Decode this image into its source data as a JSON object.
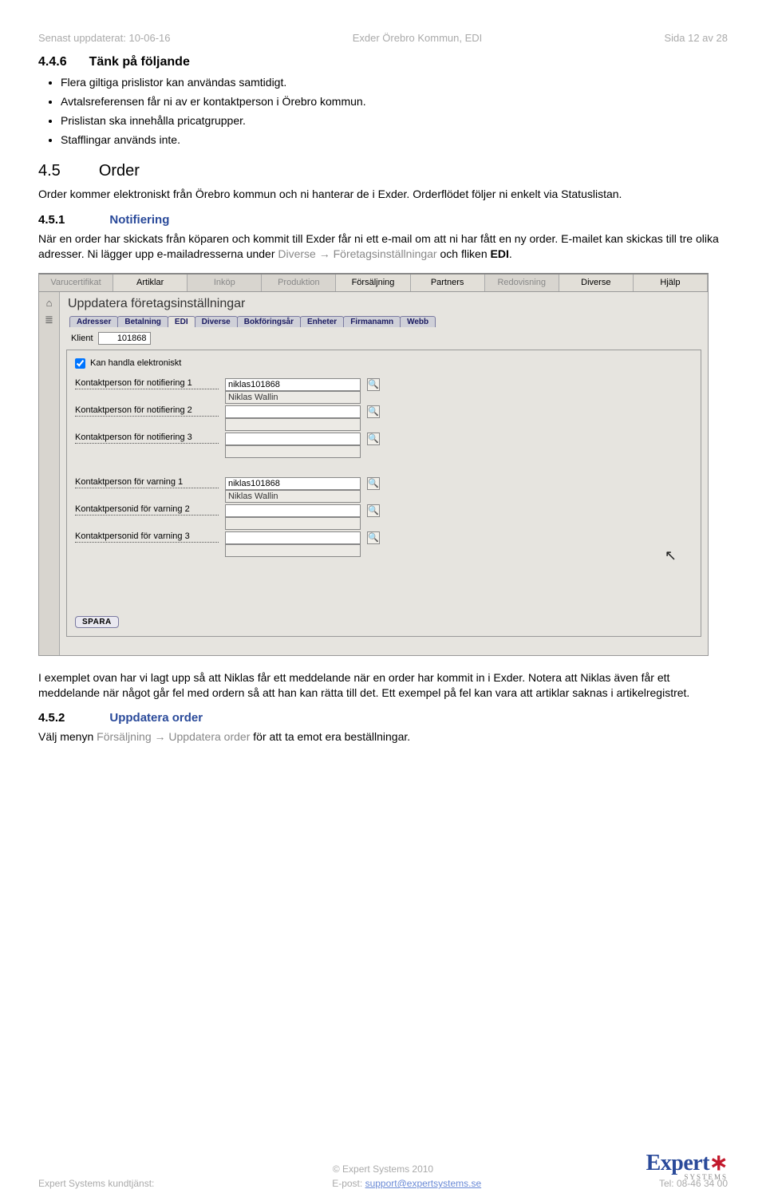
{
  "header": {
    "left": "Senast uppdaterat: 10-06-16",
    "center": "Exder Örebro Kommun, EDI",
    "right": "Sida 12 av 28"
  },
  "s446": {
    "num": "4.4.6",
    "title": "Tänk på följande"
  },
  "bullets": [
    "Flera giltiga prislistor kan användas samtidigt.",
    "Avtalsreferensen får ni av er kontaktperson i Örebro kommun.",
    "Prislistan ska innehålla pricatgrupper.",
    "Stafflingar används inte."
  ],
  "s45": {
    "num": "4.5",
    "title": "Order"
  },
  "p45": "Order kommer elektroniskt från Örebro kommun och ni hanterar de i Exder. Orderflödet följer ni enkelt via Statuslistan.",
  "s451": {
    "num": "4.5.1",
    "title": "Notifiering"
  },
  "p451_a": "När en order har skickats från köparen och kommit till Exder får ni ett e-mail om att ni har fått en ny order. E-mailet kan skickas till tre olika adresser. Ni lägger upp e-mailadresserna under ",
  "p451_link": "Diverse → Företagsinställningar",
  "p451_b": " och fliken ",
  "p451_c": "EDI",
  "p451_d": ".",
  "app": {
    "topTabs": [
      "Varucertifikat",
      "Artiklar",
      "Inköp",
      "Produktion",
      "Försäljning",
      "Partners",
      "Redovisning",
      "Diverse",
      "Hjälp"
    ],
    "inactiveTabs": [
      "Varucertifikat",
      "Inköp",
      "Produktion",
      "Redovisning"
    ],
    "mainTitle": "Uppdatera företagsinställningar",
    "subTabs": [
      "Adresser",
      "Betalning",
      "EDI",
      "Diverse",
      "Bokföringsår",
      "Enheter",
      "Firmanamn",
      "Webb"
    ],
    "activeSubTab": "EDI",
    "klientLabel": "Klient",
    "klientValue": "101868",
    "chkLabel": "Kan handla elektroniskt",
    "fields": [
      {
        "label": "Kontaktperson för notifiering 1",
        "v1": "niklas101868",
        "v2": "Niklas Wallin"
      },
      {
        "label": "Kontaktperson för notifiering 2",
        "v1": "",
        "v2": ""
      },
      {
        "label": "Kontaktperson för notifiering 3",
        "v1": "",
        "v2": ""
      }
    ],
    "fields2": [
      {
        "label": "Kontaktperson för varning 1",
        "v1": "niklas101868",
        "v2": "Niklas Wallin"
      },
      {
        "label": "Kontaktpersonid för varning 2",
        "v1": "",
        "v2": ""
      },
      {
        "label": "Kontaktpersonid för varning 3",
        "v1": "",
        "v2": ""
      }
    ],
    "saveBtn": "SPARA"
  },
  "afterImg": "I exemplet ovan har vi lagt upp så att Niklas får ett meddelande när en order har kommit in i Exder. Notera att Niklas även får ett meddelande när något går fel med ordern så att han kan rätta till det. Ett exempel på fel kan vara att artiklar saknas i artikelregistret.",
  "s452": {
    "num": "4.5.2",
    "title": "Uppdatera order"
  },
  "p452_a": "Välj menyn ",
  "p452_link": "Försäljning → Uppdatera order",
  "p452_b": " för att ta emot era beställningar.",
  "footer": {
    "copy": "© Expert Systems 2010",
    "left": "Expert Systems kundtjänst:",
    "mid_pre": "E-post: ",
    "mid_link": "support@expertsystems.se",
    "right": "Tel: 08-46 34 00"
  },
  "logo": {
    "name": "Expert",
    "sub": "SYSTEMS"
  }
}
